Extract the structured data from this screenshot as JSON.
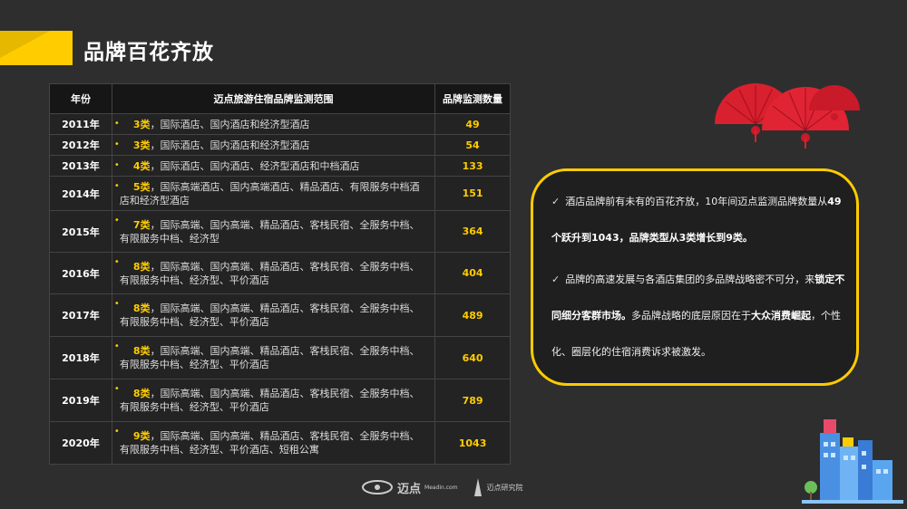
{
  "title": "品牌百花齐放",
  "table": {
    "headers": [
      "年份",
      "迈点旅游住宿品牌监测范围",
      "品牌监测数量"
    ],
    "rows": [
      {
        "year": "2011年",
        "num": "3类",
        "text": "，国际酒店、国内酒店和经济型酒店",
        "count": "49"
      },
      {
        "year": "2012年",
        "num": "3类",
        "text": "，国际酒店、国内酒店和经济型酒店",
        "count": "54"
      },
      {
        "year": "2013年",
        "num": "4类",
        "text": "，国际酒店、国内酒店、经济型酒店和中档酒店",
        "count": "133"
      },
      {
        "year": "2014年",
        "num": "5类",
        "text": "，国际高端酒店、国内高端酒店、精品酒店、有限服务中档酒店和经济型酒店",
        "count": "151"
      },
      {
        "year": "2015年",
        "num": "7类",
        "text": "，国际高端、国内高端、精品酒店、客栈民宿、全服务中档、有限服务中档、经济型",
        "count": "364"
      },
      {
        "year": "2016年",
        "num": "8类",
        "text": "，国际高端、国内高端、精品酒店、客栈民宿、全服务中档、有限服务中档、经济型、平价酒店",
        "count": "404"
      },
      {
        "year": "2017年",
        "num": "8类",
        "text": "，国际高端、国内高端、精品酒店、客栈民宿、全服务中档、有限服务中档、经济型、平价酒店",
        "count": "489"
      },
      {
        "year": "2018年",
        "num": "8类",
        "text": "，国际高端、国内高端、精品酒店、客栈民宿、全服务中档、有限服务中档、经济型、平价酒店",
        "count": "640"
      },
      {
        "year": "2019年",
        "num": "8类",
        "text": "，国际高端、国内高端、精品酒店、客栈民宿、全服务中档、有限服务中档、经济型、平价酒店",
        "count": "789"
      },
      {
        "year": "2020年",
        "num": "9类",
        "text": "，国际高端、国内高端、精品酒店、客栈民宿、全服务中档、有限服务中档、经济型、平价酒店、短租公寓",
        "count": "1043"
      }
    ]
  },
  "notes": {
    "p1_a": "酒店品牌前有未有的百花齐放，10年间迈点监测品牌数量从",
    "p1_b": "49个跃升到1043，品牌类型从3类增长到9类。",
    "p2_a": "品牌的高速发展与各酒店集团的多品牌战略密不可分，来",
    "p2_b": "锁定不同细分客群市场。",
    "p2_c": "多品牌战略的底层原因在于",
    "p2_d": "大众消费崛起",
    "p2_e": "，个性化、圈层化的住宿消费诉求被激发。"
  },
  "logos": {
    "meadin": "迈点",
    "meadin_sub": "Meadin.com",
    "institute": "迈点研究院"
  },
  "colors": {
    "accent": "#ffcc00",
    "background": "#2e2e2e",
    "fan_red": "#d8202f"
  },
  "icons": [
    "check-icon",
    "fan-decoration",
    "city-illustration"
  ]
}
